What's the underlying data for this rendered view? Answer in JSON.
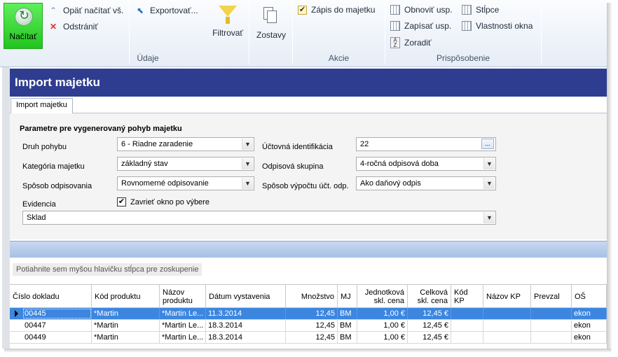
{
  "ribbon": {
    "load_label": "Načítať",
    "reload_label": "Opäť načítať vš.",
    "remove_label": "Odstrániť",
    "export_label": "Exportovať...",
    "filter_label": "Filtrovať",
    "reports_label": "Zostavy",
    "write_asset_label": "Zápis do majetku",
    "refresh_label": "Obnoviť usp.",
    "save_layout_label": "Zapísať usp.",
    "sort_label": "Zoradiť",
    "columns_label": "Stĺpce",
    "window_props_label": "Vlastnosti okna",
    "group_data": "Údaje",
    "group_actions": "Akcie",
    "group_custom": "Prispôsobenie"
  },
  "main": {
    "title": "Import majetku",
    "tab": "Import majetku",
    "section_title": "Parametre pre vygenerovaný pohyb majetku",
    "labels": {
      "movement_type": "Druh pohybu",
      "category": "Kategória majetku",
      "depreciation_method": "Spôsob odpisovania",
      "evidence": "Evidencia",
      "accounting_id": "Účtovná identifikácia",
      "depreciation_group": "Odpisová skupina",
      "calc_method": "Spôsob výpočtu účt. odp."
    },
    "values": {
      "movement_type": "6 - Riadne zaradenie",
      "category": "základný stav",
      "depreciation_method": "Rovnomerné odpisovanie",
      "accounting_id": "22",
      "depreciation_group": "4-ročná odpisová doba",
      "calc_method": "Ako daňový odpis",
      "evidence": "Sklad"
    },
    "ellipsis": "...",
    "close_window_label": "Zavrieť okno po výbere",
    "close_window_checked": true,
    "group_hint": "Potiahnite sem myšou hlavičku stĺpca pre zoskupenie"
  },
  "grid": {
    "headers": [
      "Číslo dokladu",
      "Kód produktu",
      "Názov produktu",
      "Dátum vystavenia",
      "Množstvo",
      "MJ",
      "Jednotková skl. cena",
      "Celková skl. cena",
      "Kód KP",
      "Názov KP",
      "Prevzal",
      "OŠ"
    ],
    "rows": [
      [
        "00445",
        "*Martin",
        "*Martin Le...",
        "11.3.2014",
        "12,45",
        "BM",
        "1,00 €",
        "12,45 €",
        "",
        "",
        "",
        "ekon"
      ],
      [
        "00447",
        "*Martin",
        "*Martin Le...",
        "18.3.2014",
        "12,45",
        "BM",
        "1,00 €",
        "12,45 €",
        "",
        "",
        "",
        "ekon"
      ],
      [
        "00449",
        "*Martin",
        "*Martin Le...",
        "18.3.2014",
        "12,45",
        "BM",
        "1,00 €",
        "12,45 €",
        "",
        "",
        "",
        "ekon"
      ]
    ],
    "selected_row": 0
  }
}
